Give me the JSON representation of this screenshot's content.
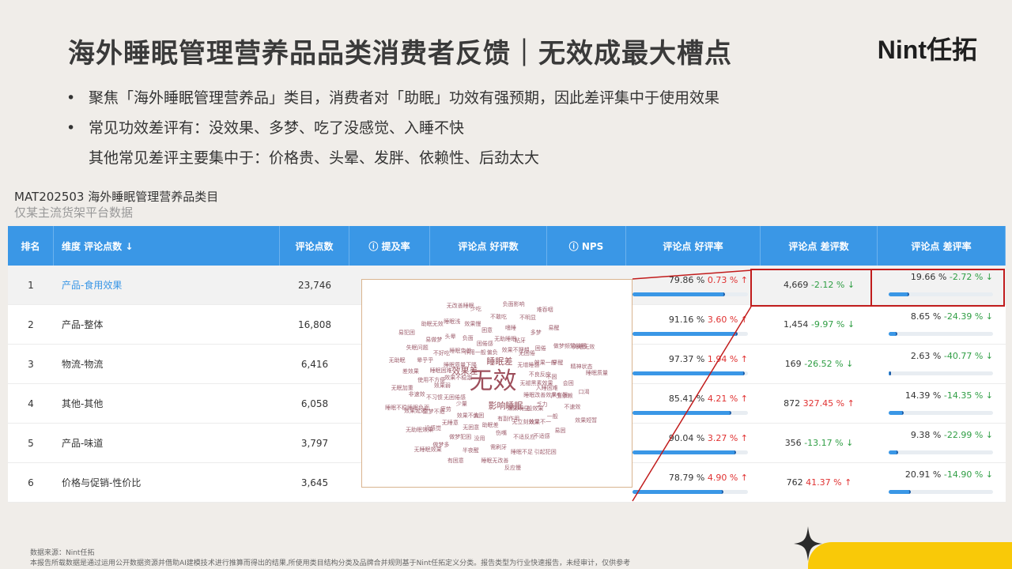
{
  "title": "海外睡眠管理营养品品类消费者反馈｜无效成最大槽点",
  "logo": "Nint任拓",
  "bullets": [
    "聚焦「海外睡眠管理营养品」类目，消费者对「助眠」功效有强预期，因此差评集中于使用效果",
    "常见功效差评有：没效果、多梦、吃了没感觉、入睡不快",
    "其他常见差评主要集中于：价格贵、头晕、发胖、依赖性、后劲太大"
  ],
  "bullet_symbol": "•",
  "subtitle": "MAT202503 海外睡眠管理营养品类目",
  "subtitle_note": "仅某主流货架平台数据",
  "table": {
    "headers": [
      "排名",
      "维度 评论点数 ↓",
      "评论点数",
      "ⓘ 提及率",
      "评论点 好评数",
      "ⓘ NPS",
      "评论点 好评率",
      "评论点 差评数",
      "评论点 差评率"
    ],
    "rows": [
      {
        "rank": "1",
        "dim": "产品-食用效果",
        "count": "23,746",
        "good_rate": "79.86 %",
        "good_delta": "0.73 % ↑",
        "good_dir": "up",
        "good_pct": 0.7986,
        "bad_count": "4,669",
        "bad_delta": "-2.12 % ↓",
        "bad_dir": "down",
        "bad_rate": "19.66 %",
        "bad_rate_delta": "-2.72 % ↓",
        "bad_rate_dir": "down",
        "bad_pct": 0.1966
      },
      {
        "rank": "2",
        "dim": "产品-整体",
        "count": "16,808",
        "good_rate": "91.16 %",
        "good_delta": "3.60 % ↑",
        "good_dir": "up",
        "good_pct": 0.9116,
        "bad_count": "1,454",
        "bad_delta": "-9.97 % ↓",
        "bad_dir": "down",
        "bad_rate": "8.65 %",
        "bad_rate_delta": "-24.39 % ↓",
        "bad_rate_dir": "down",
        "bad_pct": 0.0865
      },
      {
        "rank": "3",
        "dim": "物流-物流",
        "count": "6,416",
        "good_rate": "97.37 %",
        "good_delta": "1.94 % ↑",
        "good_dir": "up",
        "good_pct": 0.9737,
        "bad_count": "169",
        "bad_delta": "-26.52 % ↓",
        "bad_dir": "down",
        "bad_rate": "2.63 %",
        "bad_rate_delta": "-40.77 % ↓",
        "bad_rate_dir": "down",
        "bad_pct": 0.0263
      },
      {
        "rank": "4",
        "dim": "其他-其他",
        "count": "6,058",
        "good_rate": "85.41 %",
        "good_delta": "4.21 % ↑",
        "good_dir": "up",
        "good_pct": 0.8541,
        "bad_count": "872",
        "bad_delta": "327.45 % ↑",
        "bad_dir": "up",
        "bad_rate": "14.39 %",
        "bad_rate_delta": "-14.35 % ↓",
        "bad_rate_dir": "down",
        "bad_pct": 0.1439
      },
      {
        "rank": "5",
        "dim": "产品-味道",
        "count": "3,797",
        "good_rate": "90.04 %",
        "good_delta": "3.27 % ↑",
        "good_dir": "up",
        "good_pct": 0.9004,
        "bad_count": "356",
        "bad_delta": "-13.17 % ↓",
        "bad_dir": "down",
        "bad_rate": "9.38 %",
        "bad_rate_delta": "-22.99 % ↓",
        "bad_rate_dir": "down",
        "bad_pct": 0.0938
      },
      {
        "rank": "6",
        "dim": "价格与促销-性价比",
        "count": "3,645",
        "good_rate": "78.79 %",
        "good_delta": "4.90 % ↑",
        "good_dir": "up",
        "good_pct": 0.7879,
        "bad_count": "762",
        "bad_delta": "41.37 % ↑",
        "bad_dir": "up",
        "bad_rate": "20.91 %",
        "bad_rate_delta": "-14.90 % ↓",
        "bad_rate_dir": "down",
        "bad_pct": 0.2091
      }
    ]
  },
  "wordcloud": {
    "main": "无效",
    "mid": [
      "睡眠差",
      "效果差",
      "影响睡眠"
    ],
    "words": [
      "无褪黑素效果",
      "少量",
      "偏负",
      "效果明显",
      "效果不稳定",
      "无增睡感",
      "偏困",
      "作用一般",
      "睡眠改善效果有限",
      "无困倦感",
      "效果不理想",
      "有副作用",
      "睡眠质量下降",
      "不良反应",
      "效果不大",
      "困倦感",
      "一般效果",
      "效果弱",
      "无困倦",
      "助眠差",
      "睡眠变差",
      "入睡困难",
      "疲劳",
      "无助睡眠",
      "无立刻效果",
      "睡眠困难",
      "效果一般",
      "无困意",
      "负面",
      "乏力",
      "不习惯",
      "粘牙",
      "伤嘴",
      "不好吃",
      "不困",
      "无睡意",
      "困意",
      "效果不一",
      "使用不方便",
      "困倦",
      "没用",
      "头晕",
      "产生依赖",
      "做梦不适",
      "嗜睡",
      "不适反应",
      "晕乎乎",
      "早醒",
      "做梦犯困",
      "效果慢",
      "一般",
      "非速效",
      "多梦",
      "需刷牙",
      "易做梦",
      "会困",
      "没感觉",
      "不敢吃",
      "不适感",
      "差效果",
      "做梦频繁催眠",
      "半夜醒",
      "睡眠浅",
      "不速效",
      "效果延迟",
      "不明显",
      "睡眠不足",
      "失眠问题",
      "精神状态",
      "做梦多",
      "少吃",
      "易困",
      "无眠加重",
      "易醒",
      "睡眠无改善",
      "助眠无效",
      "口渴",
      "无助眠效果",
      "负面影响",
      "引起犯困",
      "无助眠",
      "失眠无效",
      "有困意",
      "无改善睡眠",
      "效果短暂",
      "睡眠不稳睡眠负面",
      "难吞咽",
      "反应慢",
      "易犯困",
      "睡眠质量",
      "无睡眠效果"
    ]
  },
  "footer_source": "数据来源：Nint任拓",
  "footer_note": "本报告所载数据是通过运用公开数据资源并借助AI建模技术进行推算而得出的结果,所使用类目结构分类及品牌合并规则基于Nint任拓定义分类。报告类型为行业快速报告，未经审计，仅供参考",
  "colors": {
    "accent": "#3a97e6",
    "up": "#e03131",
    "down": "#2f9e44",
    "highlight": "#c11c1c",
    "corner": "#f9c908"
  }
}
